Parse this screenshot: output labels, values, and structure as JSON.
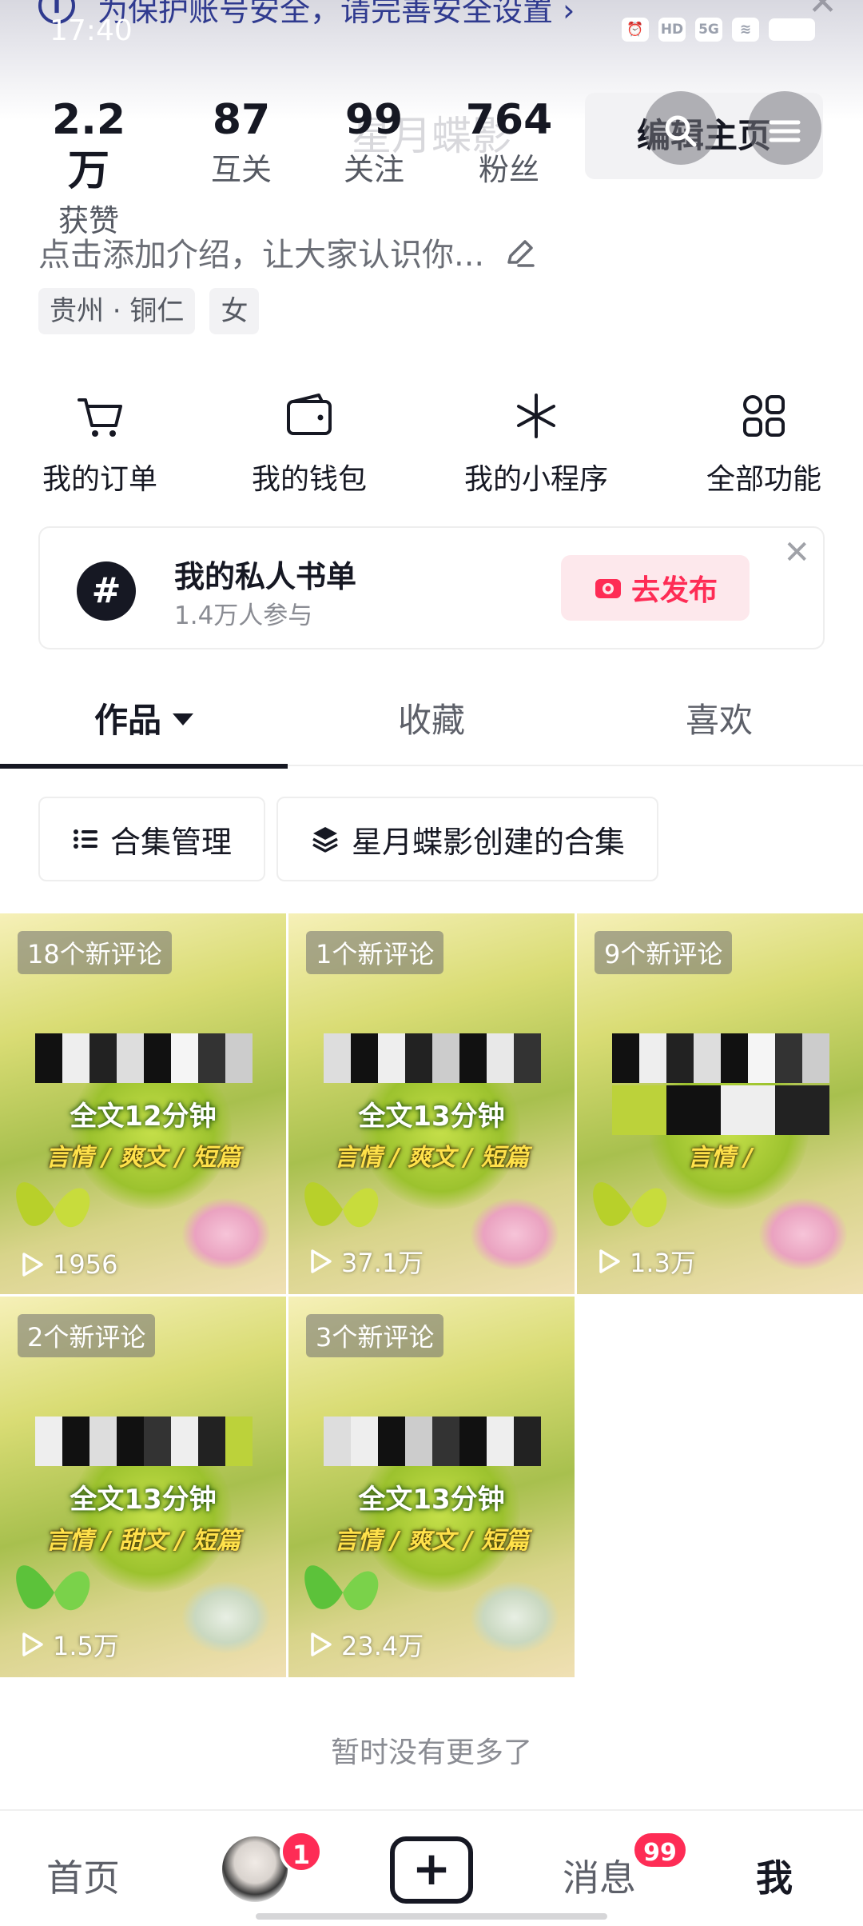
{
  "status_bar": {
    "time": "17:40",
    "icons": [
      "alarm-icon",
      "hd-icon",
      "5g-icon",
      "wifi-icon",
      "battery-icon"
    ]
  },
  "banner": {
    "text": "为保护账号安全，请完善安全设置 ›"
  },
  "profile": {
    "faded_name": "星月蝶影",
    "stats": [
      {
        "value": "2.2万",
        "label": "获赞"
      },
      {
        "value": "87",
        "label": "互关"
      },
      {
        "value": "99",
        "label": "关注"
      },
      {
        "value": "764",
        "label": "粉丝"
      }
    ],
    "edit_button": "编辑主页",
    "bio_placeholder": "点击添加介绍，让大家认识你...",
    "tags": [
      "贵州 · 铜仁",
      "女"
    ]
  },
  "shortcuts": [
    {
      "label": "我的订单",
      "icon": "cart-icon"
    },
    {
      "label": "我的钱包",
      "icon": "wallet-icon"
    },
    {
      "label": "我的小程序",
      "icon": "mini-program-icon"
    },
    {
      "label": "全部功能",
      "icon": "grid-icon"
    }
  ],
  "promo": {
    "title": "我的私人书单",
    "subtitle": "1.4万人参与",
    "button": "去发布",
    "icon": "hashtag-icon"
  },
  "tabs": [
    "作品",
    "收藏",
    "喜欢"
  ],
  "active_tab": "作品",
  "chips": [
    "合集管理",
    "星月蝶影创建的合集"
  ],
  "videos": [
    {
      "badge": "18个新评论",
      "title": "全文12分钟",
      "genres": "言情 / 爽文 / 短篇",
      "plays": "1956"
    },
    {
      "badge": "1个新评论",
      "title": "全文13分钟",
      "genres": "言情 / 爽文 / 短篇",
      "plays": "37.1万"
    },
    {
      "badge": "9个新评论",
      "title": "",
      "genres": "言情 / ",
      "plays": "1.3万"
    },
    {
      "badge": "2个新评论",
      "title": "全文13分钟",
      "genres": "言情 / 甜文 / 短篇",
      "plays": "1.5万"
    },
    {
      "badge": "3个新评论",
      "title": "全文13分钟",
      "genres": "言情 / 爽文 / 短篇",
      "plays": "23.4万"
    }
  ],
  "no_more": "暂时没有更多了",
  "bottom_nav": {
    "home": "首页",
    "add": "+",
    "messages": "消息",
    "me": "我",
    "friend_badge": "1",
    "messages_badge": "99"
  },
  "colors": {
    "accent": "#fe2c55",
    "text": "#161823",
    "muted": "#8a8c93",
    "banner_text": "#2f3a8f"
  }
}
